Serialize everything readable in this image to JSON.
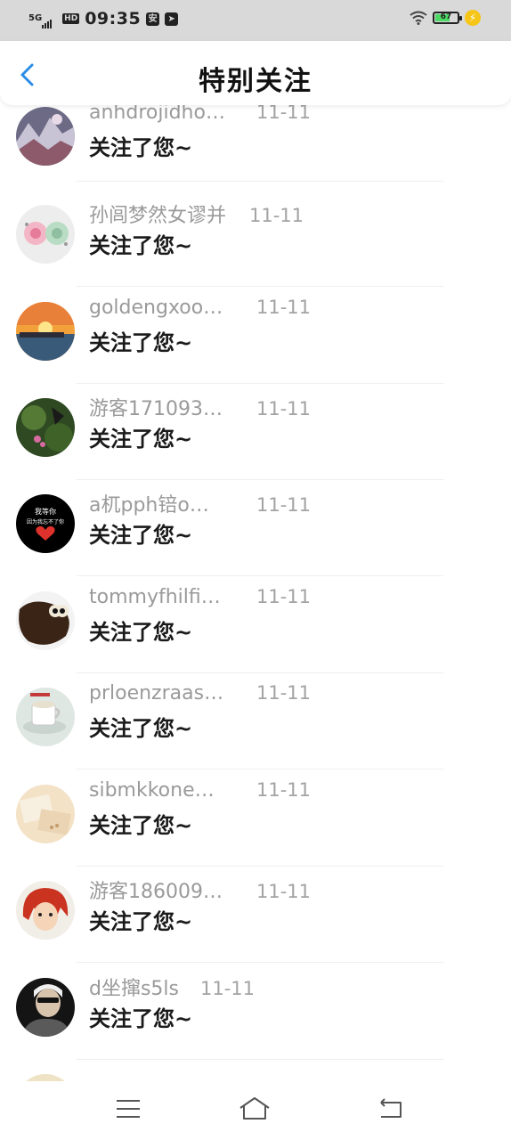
{
  "status_bar": {
    "network": "5G",
    "hd": "HD",
    "time": "09:35",
    "icon_a": "安",
    "battery": "67",
    "colors": {
      "battery_fill": "#4cd964",
      "charge": "#f5c518"
    }
  },
  "header": {
    "title": "特别关注",
    "back_icon": "chevron-left-icon",
    "accent": "#2b8ce6"
  },
  "messages": [
    {
      "name": "anhdrojidho…",
      "date": "11-11",
      "text": "关注了您~"
    },
    {
      "name": "孙闾梦然女谬并",
      "date": "11-11",
      "text": "关注了您~"
    },
    {
      "name": "goldengxoo…",
      "date": "11-11",
      "text": "关注了您~"
    },
    {
      "name": "游客171093…",
      "date": "11-11",
      "text": "关注了您~"
    },
    {
      "name": "a杌pph锫o…",
      "date": "11-11",
      "text": "关注了您~",
      "avatar_text_1": "我等你",
      "avatar_text_2": "因为我忘不了你"
    },
    {
      "name": "tommyfhilfi…",
      "date": "11-11",
      "text": "关注了您~"
    },
    {
      "name": "prloenzraas…",
      "date": "11-11",
      "text": "关注了您~"
    },
    {
      "name": "sibmkkone…",
      "date": "11-11",
      "text": "关注了您~"
    },
    {
      "name": "游客186009…",
      "date": "11-11",
      "text": "关注了您~"
    },
    {
      "name": "d坐撺s5ls",
      "date": "11-11",
      "text": "关注了您~"
    }
  ],
  "bottom_nav": {
    "items": [
      "menu-icon",
      "home-icon",
      "back-icon"
    ]
  }
}
